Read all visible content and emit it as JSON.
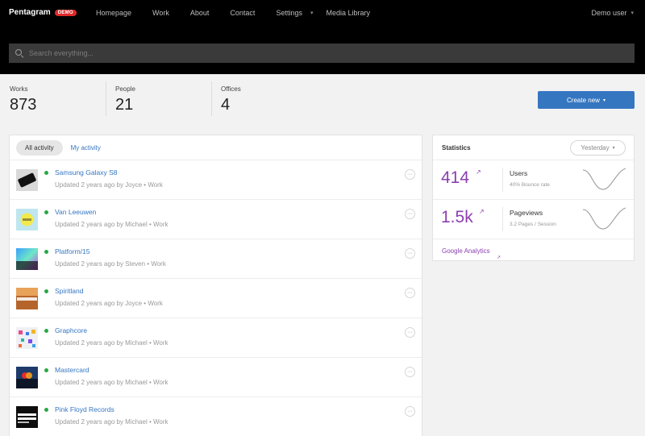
{
  "brand": {
    "name": "Pentagram",
    "badge": "DEMO"
  },
  "nav": {
    "items": [
      "Homepage",
      "Work",
      "About",
      "Contact",
      "Settings",
      "Media Library"
    ],
    "user": "Demo user"
  },
  "search": {
    "placeholder": "Search everything..."
  },
  "stats": [
    {
      "label": "Works",
      "value": "873"
    },
    {
      "label": "People",
      "value": "21"
    },
    {
      "label": "Offices",
      "value": "4"
    }
  ],
  "create_button": {
    "label": "Create new"
  },
  "activity": {
    "tabs": [
      "All activity",
      "My activity"
    ],
    "items": [
      {
        "title": "Samsung Galaxy S8",
        "meta": "Updated 2 years ago by Joyce",
        "type": "Work",
        "thumb": "samsung"
      },
      {
        "title": "Van Leeuwen",
        "meta": "Updated 2 years ago by Michael",
        "type": "Work",
        "thumb": "vanleeuwen"
      },
      {
        "title": "Platform/15",
        "meta": "Updated 2 years ago by Steven",
        "type": "Work",
        "thumb": "platform"
      },
      {
        "title": "Spiritland",
        "meta": "Updated 2 years ago by Joyce",
        "type": "Work",
        "thumb": "spiritland"
      },
      {
        "title": "Graphcore",
        "meta": "Updated 2 years ago by Michael",
        "type": "Work",
        "thumb": "graphcore"
      },
      {
        "title": "Mastercard",
        "meta": "Updated 2 years ago by Michael",
        "type": "Work",
        "thumb": "mastercard"
      },
      {
        "title": "Pink Floyd Records",
        "meta": "Updated 2 years ago by Michael",
        "type": "Work",
        "thumb": "pinkfloyd"
      }
    ]
  },
  "statistics": {
    "title": "Statistics",
    "period": "Yesterday",
    "metrics": [
      {
        "value": "414",
        "name": "Users",
        "sub": "40% Bounce rate"
      },
      {
        "value": "1.5k",
        "name": "Pageviews",
        "sub": "3.2 Pages / Session"
      }
    ],
    "link": "Google Analytics"
  },
  "colors": {
    "accent": "#8b3fb1",
    "link": "#3576c1",
    "primary_button": "#3576c1",
    "online_dot": "#27a844"
  }
}
